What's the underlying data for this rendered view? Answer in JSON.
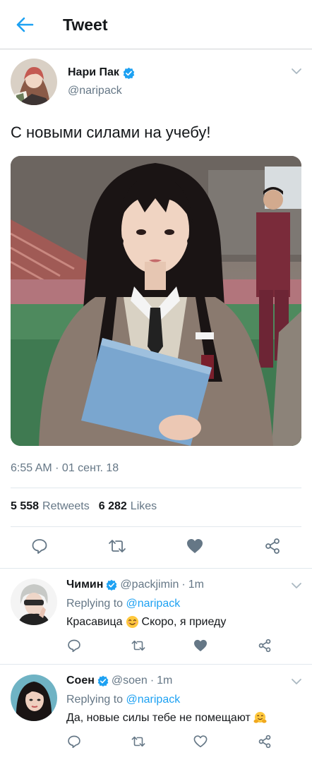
{
  "header": {
    "title": "Tweet",
    "back_icon": "arrow-left-icon"
  },
  "colors": {
    "accent": "#1da1f2",
    "secondary_text": "#657786",
    "divider": "#e1e8ed"
  },
  "tweet": {
    "author_name": "Нари Пак",
    "author_handle": "@naripack",
    "verified": true,
    "text": "С новыми силами на учебу!",
    "timestamp": "6:55 AM · 01 сент. 18",
    "retweets_count": "5 558",
    "retweets_label": "Retweets",
    "likes_count": "6 282",
    "likes_label": "Likes",
    "actions": [
      "reply-icon",
      "retweet-icon",
      "heart-icon",
      "share-icon"
    ]
  },
  "replies": [
    {
      "author_name": "Чимин",
      "verified": true,
      "handle": "@packjimin",
      "separator": "·",
      "time": "1m",
      "replying_prefix": "Replying to",
      "replying_to": "@naripack",
      "text_before": "Красавица",
      "emoji": "smiling-face-emoji",
      "text_after": "Скоро, я приеду",
      "liked": true
    },
    {
      "author_name": "Соен",
      "verified": true,
      "handle": "@soen",
      "separator": "·",
      "time": "1m",
      "replying_prefix": "Replying to",
      "replying_to": "@naripack",
      "text_before": "Да, новые силы тебе не помещают",
      "emoji": "hugging-face-emoji",
      "text_after": "",
      "liked": false
    }
  ]
}
